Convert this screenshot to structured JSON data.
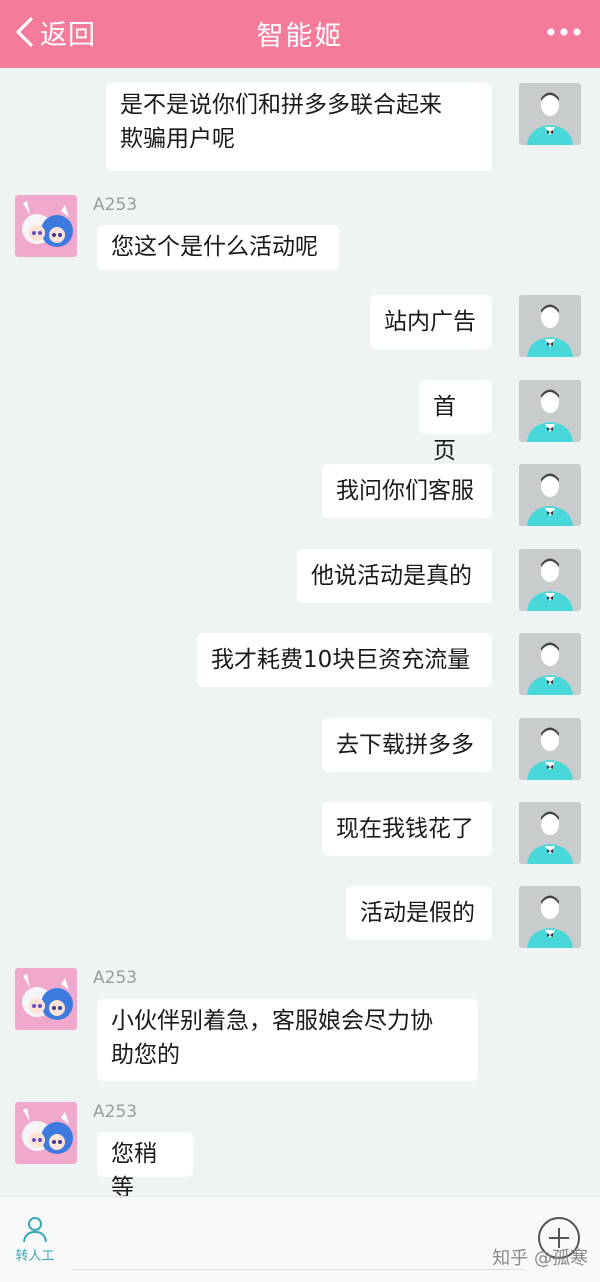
{
  "header": {
    "back_label": "返回",
    "title": "智能姬"
  },
  "bot_name": "A253",
  "colors": {
    "header": "#f47b9a",
    "background": "#eef3f3",
    "accent": "#3aa7b8"
  },
  "messages": [
    {
      "side": "user",
      "text": "是不是说你们和拼多多联合起来\n欺骗用户呢"
    },
    {
      "side": "bot",
      "text": "您这个是什么活动呢"
    },
    {
      "side": "user",
      "text": "站内广告"
    },
    {
      "side": "user",
      "text": "首页"
    },
    {
      "side": "user",
      "text": "我问你们客服"
    },
    {
      "side": "user",
      "text": "他说活动是真的"
    },
    {
      "side": "user",
      "text": "我才耗费10块巨资充流量"
    },
    {
      "side": "user",
      "text": "去下载拼多多"
    },
    {
      "side": "user",
      "text": "现在我钱花了"
    },
    {
      "side": "user",
      "text": "活动是假的"
    },
    {
      "side": "bot",
      "text": "小伙伴别着急，客服娘会尽力协\n助您的"
    },
    {
      "side": "bot",
      "text": "您稍等"
    }
  ],
  "bottom": {
    "human_label": "转人工"
  },
  "watermark": "知乎 @孤寒"
}
